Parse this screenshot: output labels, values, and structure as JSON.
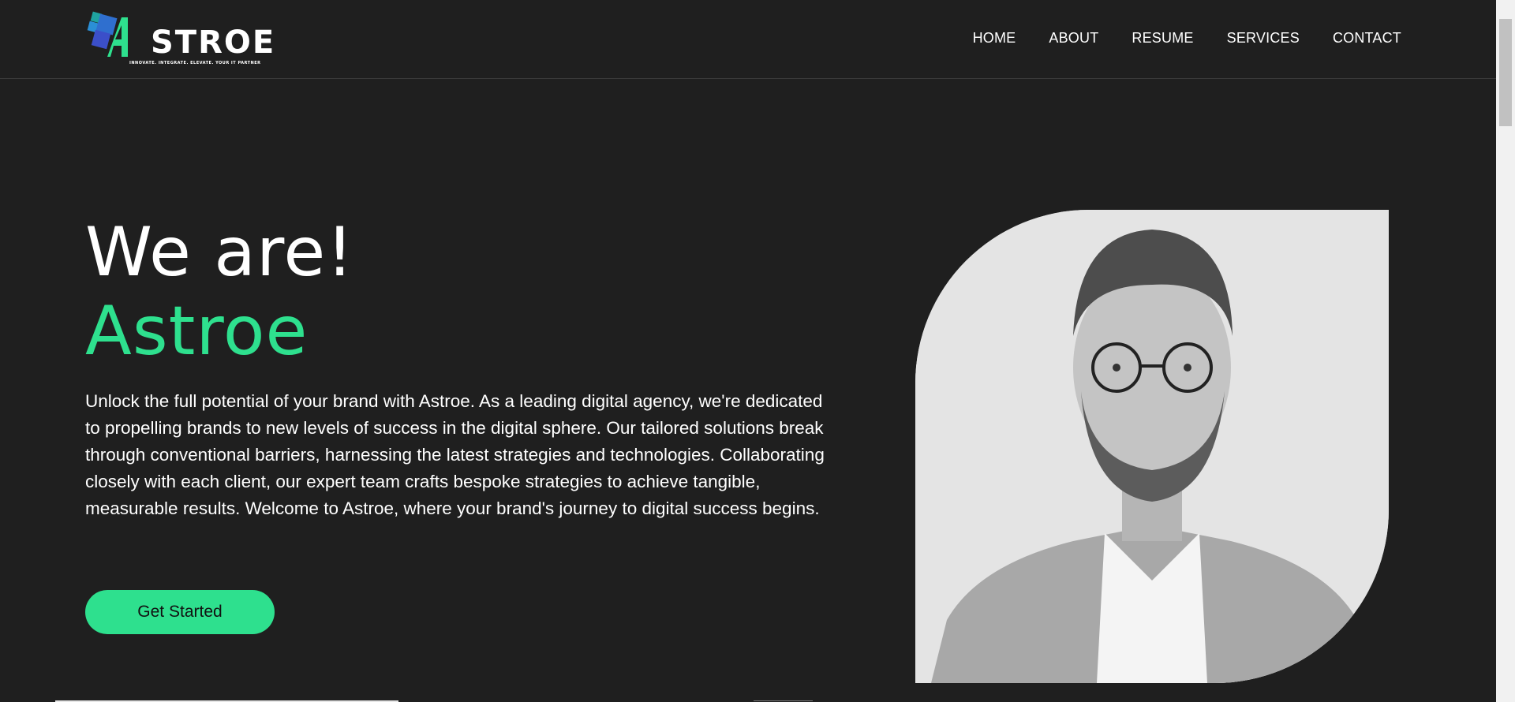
{
  "brand": {
    "name_first_letter": "A",
    "name_rest": "STROE",
    "tagline": "INNOVATE. INTEGRATE. ELEVATE. YOUR IT PARTNER",
    "accent_color": "#2ee08e",
    "background_color": "#1f1f1f"
  },
  "nav": {
    "items": [
      {
        "label": "HOME"
      },
      {
        "label": "ABOUT"
      },
      {
        "label": "RESUME"
      },
      {
        "label": "SERVICES"
      },
      {
        "label": "CONTACT"
      }
    ]
  },
  "hero": {
    "heading_line1": "We are!",
    "heading_line2": "Astroe",
    "description": "Unlock the full potential of your brand with Astroe. As a leading digital agency, we're dedicated to propelling brands to new levels of success in the digital sphere. Our tailored solutions break through conventional barriers, harnessing the latest strategies and technologies. Collaborating closely with each client, our expert team crafts bespoke strategies to achieve tangible, measurable results. Welcome to Astroe, where your brand's journey to digital success begins.",
    "cta_label": "Get Started"
  },
  "icons": {
    "logo": "astroe-logo-icon",
    "portrait": "portrait-photo"
  }
}
